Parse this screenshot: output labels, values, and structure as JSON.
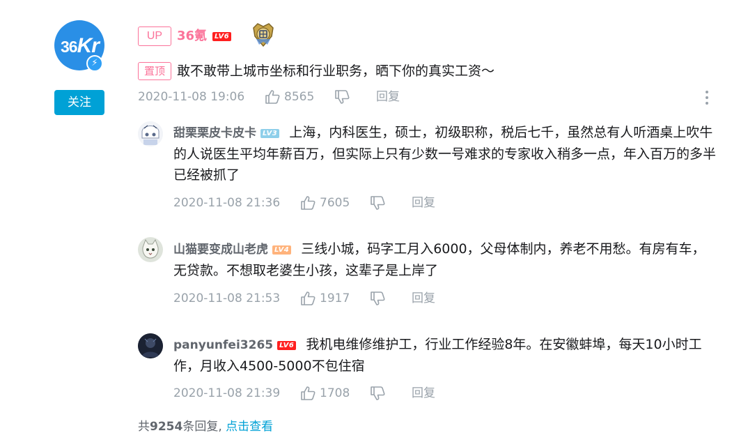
{
  "main_comment": {
    "avatar_logo": "36Kr",
    "follow_label": "关注",
    "up_tag": "UP",
    "username": "36氪",
    "level": "LV6",
    "pinned_tag": "置顶",
    "text": "敢不敢带上城市坐标和行业职务，晒下你的真实工资～",
    "time": "2020-11-08 19:06",
    "likes": "8565",
    "reply_label": "回复"
  },
  "replies": [
    {
      "username": "甜栗栗皮卡皮卡",
      "level": "LV3",
      "text": "上海，内科医生，硕士，初级职称，税后七千，虽然总有人听酒桌上吹牛的人说医生平均年薪百万，但实际上只有少数一号难求的专家收入稍多一点，年入百万的多半已经被抓了",
      "time": "2020-11-08 21:36",
      "likes": "7605",
      "reply_label": "回复"
    },
    {
      "username": "山猫要变成山老虎",
      "level": "LV4",
      "text": "三线小城，码字工月入6000，父母体制内，养老不用愁。有房有车，无贷款。不想取老婆生小孩，这辈子是上岸了",
      "time": "2020-11-08 21:53",
      "likes": "1917",
      "reply_label": "回复"
    },
    {
      "username": "panyunfei3265",
      "level": "LV6",
      "text": "我机电维修维护工，行业工作经验8年。在安徽蚌埠，每天10小时工作，月收入4500-5000不包住宿",
      "time": "2020-11-08 21:39",
      "likes": "1708",
      "reply_label": "回复"
    }
  ],
  "footer": {
    "prefix": "共",
    "count": "9254",
    "suffix": "条回复,",
    "link": "点击查看"
  },
  "colors": {
    "accent_pink": "#fb7299",
    "accent_blue": "#00a1d6",
    "meta_gray": "#99a2aa"
  }
}
